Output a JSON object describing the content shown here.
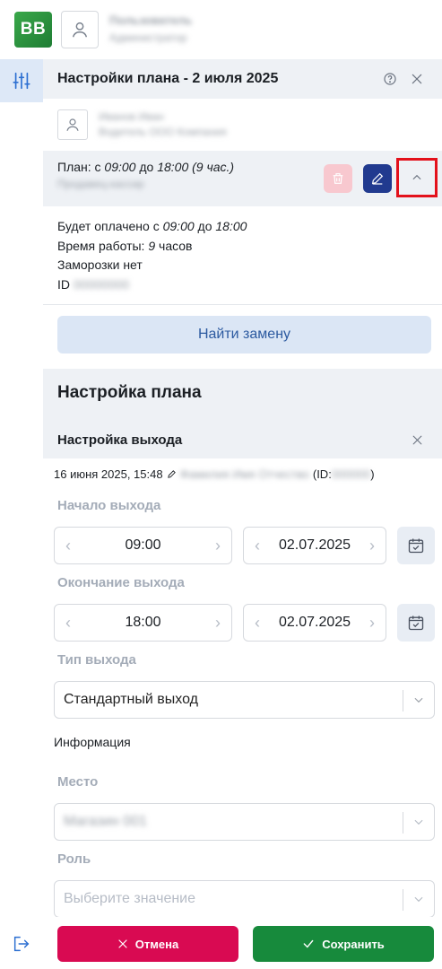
{
  "app": {
    "logo_text": "BB"
  },
  "header": {
    "user_name": "Пользователь",
    "user_sub": "Администратор"
  },
  "panel": {
    "title": "Настройки плана - 2 июля 2025",
    "person_name": "Иванов Иван",
    "person_sub": "Водитель ООО Компания"
  },
  "plan": {
    "prefix": "План: с ",
    "from": "09:00",
    "mid": " до ",
    "to": "18:00",
    "duration": " (9 час.)",
    "sub": "Продавец-кассир"
  },
  "details": {
    "paid_prefix": "Будет оплачено с ",
    "paid_from": "09:00",
    "paid_mid": " до ",
    "paid_to": "18:00",
    "work_prefix": "Время работы: ",
    "work_hours": "9",
    "work_suffix": " часов",
    "freeze": "Заморозки нет",
    "id_label": "ID",
    "id_value": "00000000"
  },
  "find_button": "Найти замену",
  "setup": {
    "title": "Настройка плана",
    "exit_title": "Настройка выхода",
    "meta_date": "16 июня 2025, 15:48",
    "meta_author": "Фамилия Имя Отчество",
    "meta_id_prefix": "(ID: ",
    "meta_id_value": "000000",
    "meta_id_suffix": ")",
    "start_label": "Начало выхода",
    "start_time": "09:00",
    "start_date": "02.07.2025",
    "end_label": "Окончание выхода",
    "end_time": "18:00",
    "end_date": "02.07.2025",
    "type_label": "Тип выхода",
    "type_value": "Стандартный выход",
    "info_label": "Информация",
    "place_label": "Место",
    "place_value": "Магазин 001",
    "role_label": "Роль",
    "role_placeholder": "Выберите значение"
  },
  "footer": {
    "cancel": "Отмена",
    "save": "Сохранить"
  },
  "colors": {
    "accent": "#213a8f",
    "danger": "#d90a52",
    "success": "#178a3c",
    "highlight": "#e3111b"
  }
}
